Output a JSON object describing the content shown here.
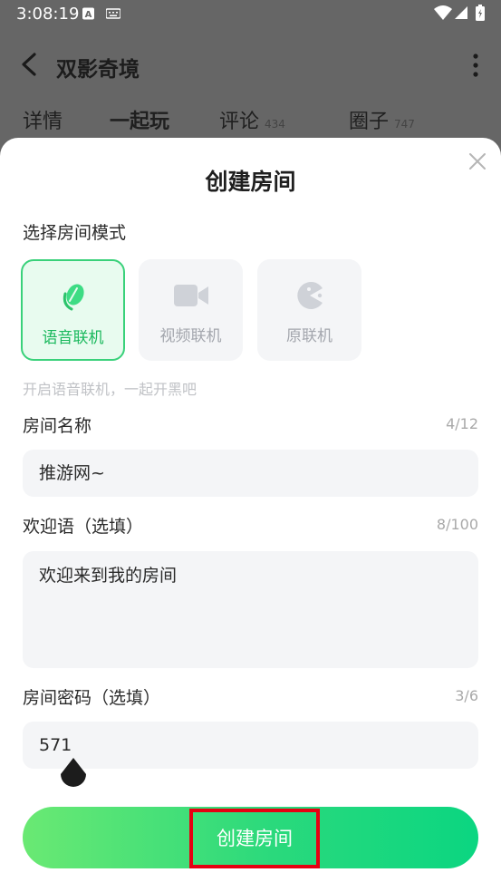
{
  "status_bar": {
    "time": "3:08:19",
    "icons": [
      "a-badge-icon",
      "keyboard-icon",
      "wifi-icon",
      "signal-icon",
      "battery-icon"
    ]
  },
  "header": {
    "title": "双影奇境",
    "tabs": [
      {
        "label": "详情",
        "badge": ""
      },
      {
        "label": "一起玩",
        "badge": ""
      },
      {
        "label": "评论",
        "badge": "434"
      },
      {
        "label": "圈子",
        "badge": "747"
      }
    ],
    "active_tab": "一起玩"
  },
  "sheet": {
    "title": "创建房间",
    "mode_section_label": "选择房间模式",
    "modes": [
      {
        "label": "语音联机",
        "icon": "microphone-icon",
        "selected": true
      },
      {
        "label": "视频联机",
        "icon": "video-camera-icon",
        "selected": false
      },
      {
        "label": "原联机",
        "icon": "game-pacman-icon",
        "selected": false
      }
    ],
    "mode_hint": "开启语音联机，一起开黑吧",
    "room_name": {
      "label": "房间名称",
      "counter": "4/12",
      "value": "推游网~"
    },
    "welcome": {
      "label": "欢迎语（选填）",
      "counter": "8/100",
      "value": "欢迎来到我的房间"
    },
    "password": {
      "label": "房间密码（选填）",
      "counter": "3/6",
      "value": "571"
    },
    "create_button": "创建房间"
  },
  "colors": {
    "accent_green": "#39d17a",
    "button_gradient_start": "#6ae973",
    "button_gradient_end": "#0bd681",
    "highlight_box": "#e60012"
  }
}
